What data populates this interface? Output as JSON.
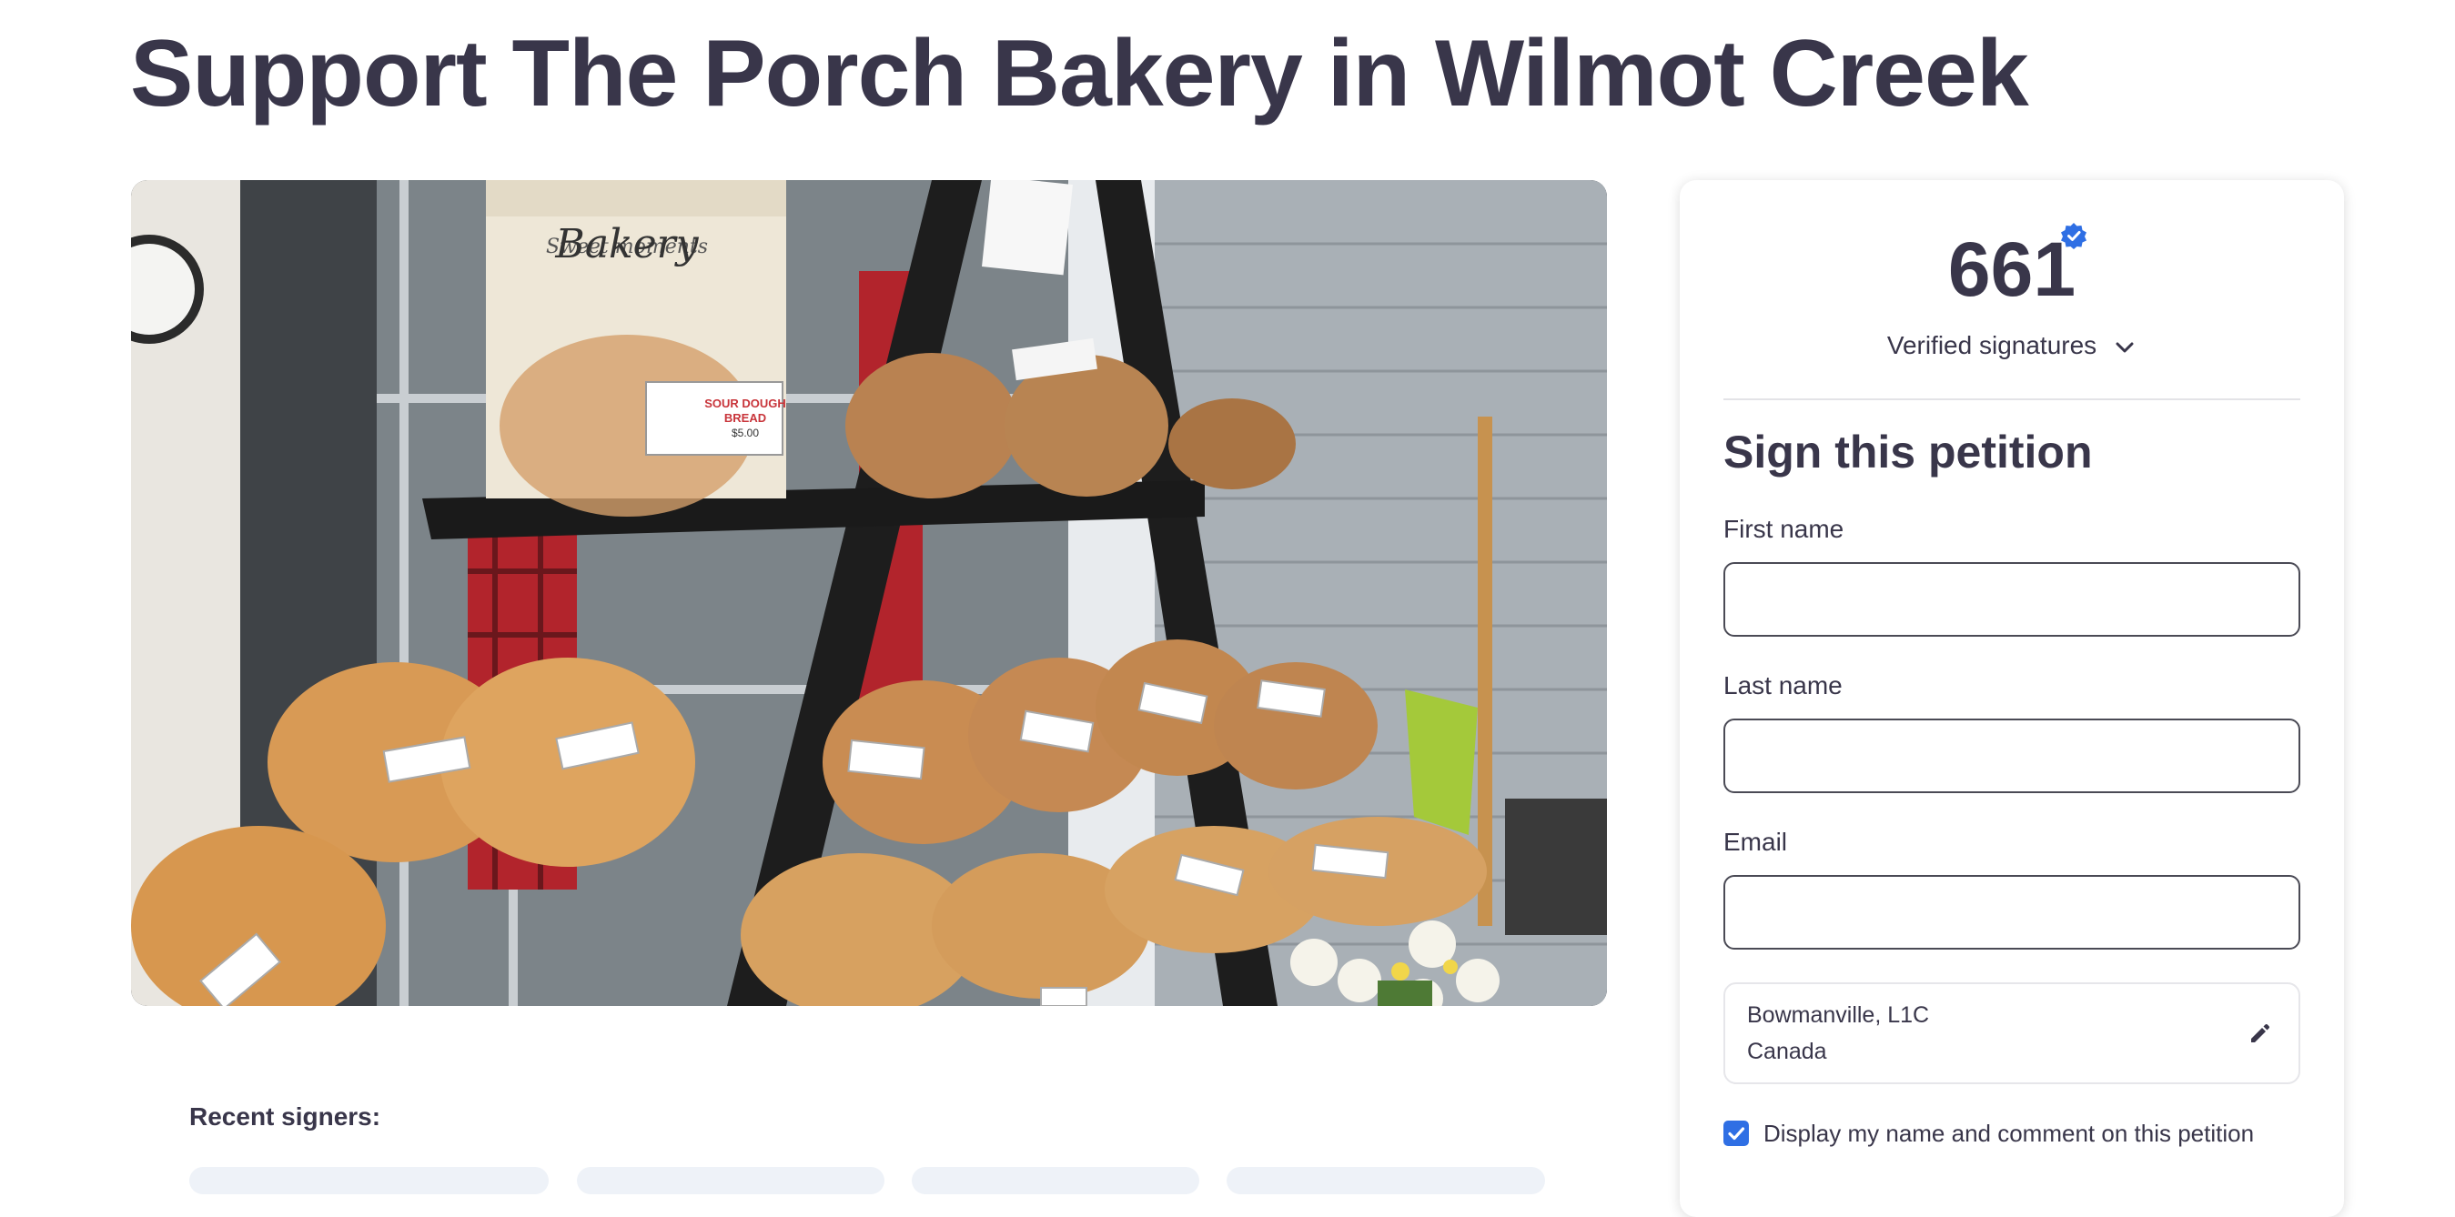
{
  "petition": {
    "title": "Support The Porch Bakery in Wilmot Creek"
  },
  "photo": {
    "bag_brand": "Bakery",
    "bag_tagline": "Sweet moments",
    "bag_label_line1": "SOUR DOUGH",
    "bag_label_line2": "BREAD",
    "bag_label_price": "$5.00"
  },
  "recent_signers": {
    "label": "Recent signers:"
  },
  "signatures": {
    "count": "661",
    "verified_label": "Verified signatures"
  },
  "form": {
    "heading": "Sign this petition",
    "first_name_label": "First name",
    "first_name_value": "",
    "last_name_label": "Last name",
    "last_name_value": "",
    "email_label": "Email",
    "email_value": "",
    "location_line1": "Bowmanville, L1C",
    "location_line2": "Canada",
    "display_checked": true,
    "display_label": "Display my name and comment on this petition"
  },
  "colors": {
    "text": "#39364a",
    "accent": "#2f6fe4"
  }
}
